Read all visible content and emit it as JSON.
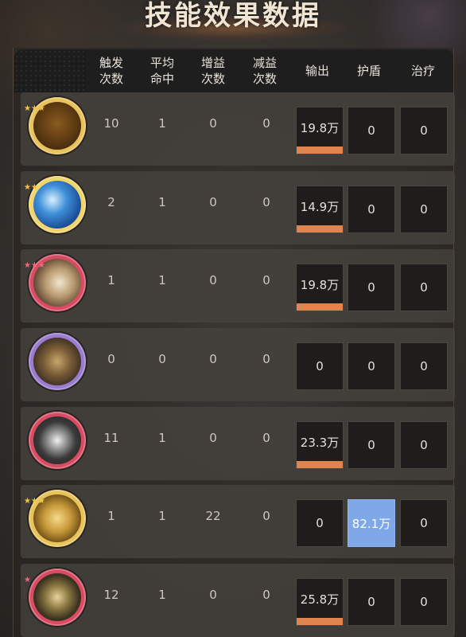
{
  "title": "技能效果数据",
  "headers": [
    "触发\n次数",
    "平均\n命中",
    "增益\n次数",
    "减益\n次数",
    "输出",
    "护盾",
    "治疗"
  ],
  "rows": [
    {
      "icon": "golden-swords-skill-icon",
      "stars": "★★★",
      "star_color": "#f4c542",
      "ring": "#e8c25a",
      "trigger": "10",
      "avg_hit": "1",
      "buff": "0",
      "debuff": "0",
      "output": "19.8万",
      "output_fill": 1.0,
      "shield": "0",
      "heal": "0",
      "shield_highlight": false
    },
    {
      "icon": "blue-wave-skill-icon",
      "stars": "★★",
      "star_color": "#f4c542",
      "ring": "#f1d46a",
      "trigger": "2",
      "avg_hit": "1",
      "buff": "0",
      "debuff": "0",
      "output": "14.9万",
      "output_fill": 1.0,
      "shield": "0",
      "heal": "0",
      "shield_highlight": false
    },
    {
      "icon": "crescent-slash-skill-icon",
      "stars": "★★★",
      "star_color": "#f06a7a",
      "ring": "#d94a63",
      "trigger": "1",
      "avg_hit": "1",
      "buff": "0",
      "debuff": "0",
      "output": "19.8万",
      "output_fill": 1.0,
      "shield": "0",
      "heal": "0",
      "shield_highlight": false
    },
    {
      "icon": "golden-dragon-skill-icon",
      "stars": "",
      "star_color": "#f4c542",
      "ring": "#9a7bd0",
      "trigger": "0",
      "avg_hit": "0",
      "buff": "0",
      "debuff": "0",
      "output": "0",
      "output_fill": 0,
      "shield": "0",
      "heal": "0",
      "shield_highlight": false
    },
    {
      "icon": "shield-emblem-skill-icon",
      "stars": "",
      "star_color": "#f06a7a",
      "ring": "#d94a63",
      "trigger": "11",
      "avg_hit": "1",
      "buff": "0",
      "debuff": "0",
      "output": "23.3万",
      "output_fill": 1.0,
      "shield": "0",
      "heal": "0",
      "shield_highlight": false
    },
    {
      "icon": "golden-ring-skill-icon",
      "stars": "★★★",
      "star_color": "#f4c542",
      "ring": "#e8c25a",
      "trigger": "1",
      "avg_hit": "1",
      "buff": "22",
      "debuff": "0",
      "output": "0",
      "output_fill": 0,
      "shield": "82.1万",
      "heal": "0",
      "shield_highlight": true
    },
    {
      "icon": "hexagon-crest-skill-icon",
      "stars": "★",
      "star_color": "#f06a7a",
      "ring": "#d94a63",
      "trigger": "12",
      "avg_hit": "1",
      "buff": "0",
      "debuff": "0",
      "output": "25.8万",
      "output_fill": 1.0,
      "shield": "0",
      "heal": "0",
      "shield_highlight": false
    }
  ]
}
